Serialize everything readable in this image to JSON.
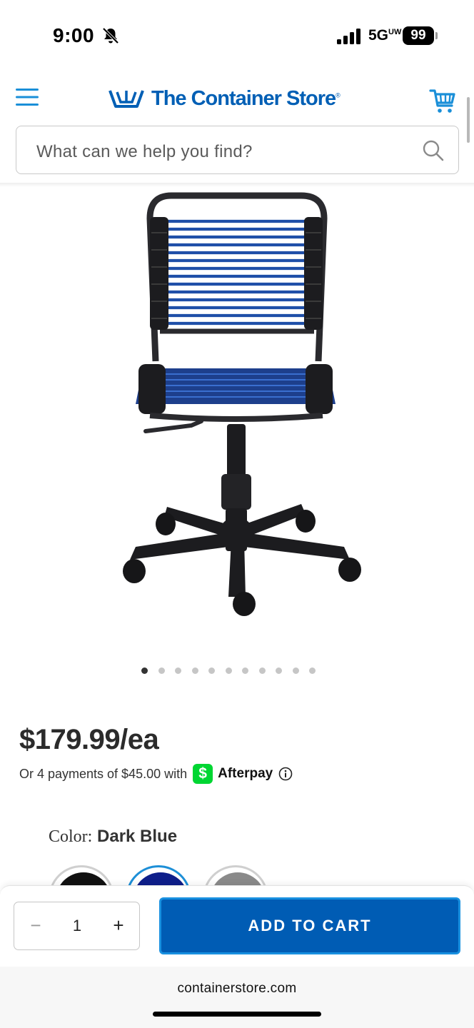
{
  "status_bar": {
    "time": "9:00",
    "network": "5G",
    "network_suffix": "UW",
    "battery": "99",
    "icons": [
      "bell-slash-icon",
      "signal-icon"
    ]
  },
  "header": {
    "brand": "The Container Store",
    "brand_mark": "®",
    "brand_color": "#005fb5",
    "icons": [
      "menu-icon",
      "logo-mark-icon",
      "cart-icon"
    ]
  },
  "search": {
    "placeholder": "What can we help you find?",
    "icon": "search-icon"
  },
  "gallery": {
    "image": "dark-blue-bungee-office-chair",
    "dot_count": 11,
    "active_index": 0
  },
  "product": {
    "price": "$179.99/ea",
    "installment_prefix": "Or 4 payments of $45.00 with",
    "cashapp_glyph": "$",
    "afterpay": "Afterpay"
  },
  "color": {
    "label": "Color:",
    "selected": "Dark Blue",
    "swatch_colors": [
      "#111111",
      "#0e1e8a",
      "#8a8a8a"
    ]
  },
  "cart_bar": {
    "minus": "−",
    "quantity": "1",
    "plus": "+",
    "button": "ADD TO CART",
    "button_color": "#005cb4"
  },
  "browser": {
    "url": "containerstore.com"
  }
}
